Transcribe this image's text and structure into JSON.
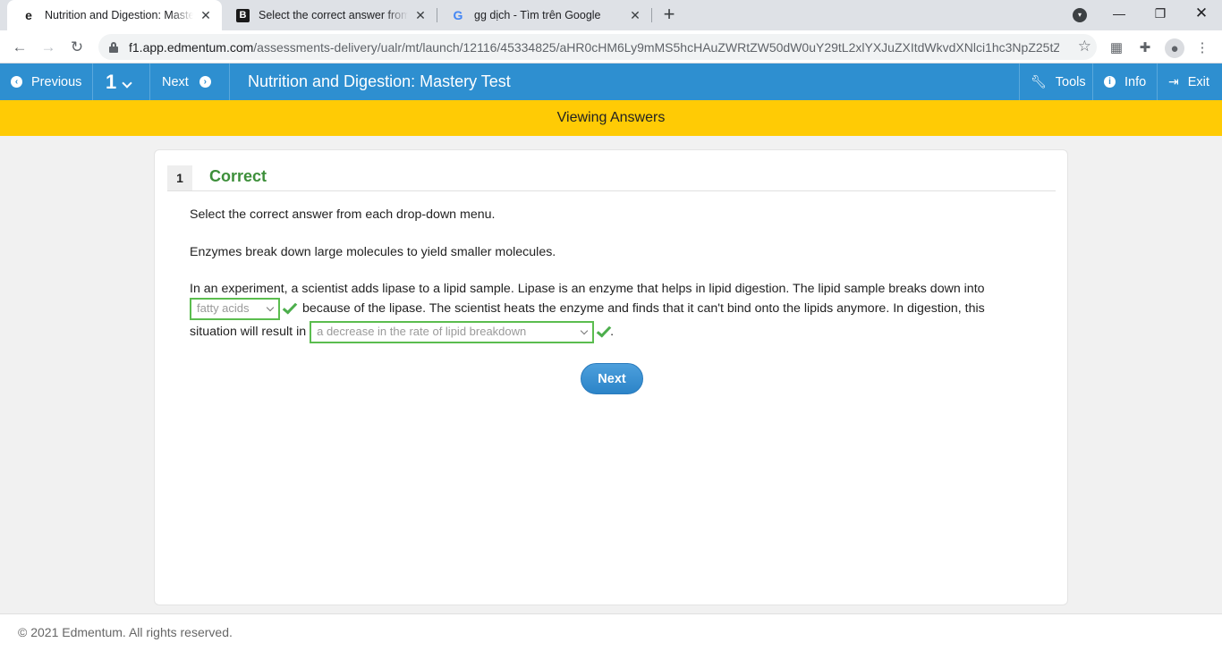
{
  "browser": {
    "tabs": [
      {
        "title": "Nutrition and Digestion: Mastery",
        "active": true
      },
      {
        "title": "Select the correct answer from th",
        "active": false
      },
      {
        "title": "gg dịch - Tìm trên Google",
        "active": false
      }
    ],
    "url_host": "f1.app.edmentum.com",
    "url_path": "/assessments-delivery/ualr/mt/launch/12116/45334825/aHR0cHM6Ly9mMS5hcHAuZWRtZW50dW0uY29tL2xlYXJuZXItdWkvdXNlci1hc3NpZ25tZ..."
  },
  "appbar": {
    "previous_label": "Previous",
    "question_number": "1",
    "next_label": "Next",
    "title": "Nutrition and Digestion: Mastery Test",
    "tools_label": "Tools",
    "info_label": "Info",
    "exit_label": "Exit"
  },
  "banner": {
    "text": "Viewing Answers"
  },
  "question": {
    "number": "1",
    "status": "Correct",
    "instruction": "Select the correct answer from each drop-down menu.",
    "statement": "Enzymes break down large molecules to yield smaller molecules.",
    "line1": "In an experiment, a scientist adds lipase to a lipid sample. Lipase is an enzyme that helps in lipid digestion. The lipid sample breaks down into",
    "dropdown1_value": "fatty acids",
    "line2": "because of the lipase. The scientist heats the enzyme and finds that it can't bind onto the lipids anymore. In digestion, this",
    "line3_prefix": "situation will result in",
    "dropdown2_value": "a decrease in the rate of lipid breakdown",
    "line3_suffix": ".",
    "next_button": "Next"
  },
  "footer": {
    "copyright": "© 2021 Edmentum. All rights reserved."
  },
  "colors": {
    "header_blue": "#2e8fd0",
    "banner_yellow": "#ffcb05",
    "correct_green": "#3d8f3a"
  }
}
